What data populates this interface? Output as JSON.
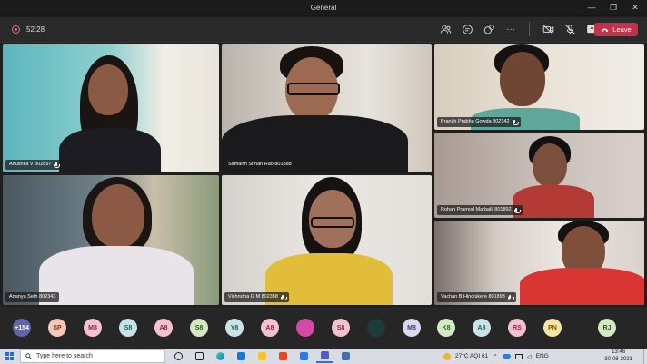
{
  "window": {
    "title": "General"
  },
  "window_controls": {
    "minimize": "—",
    "restore": "❐",
    "close": "✕"
  },
  "meeting": {
    "timer": "52:28",
    "leave_label": "Leave"
  },
  "toolbar_icons": [
    "people-icon",
    "chat-icon",
    "reactions-icon",
    "more-icon",
    "camera-off-icon",
    "mic-off-icon",
    "share-icon"
  ],
  "more_glyph": "···",
  "participants": [
    {
      "name": "Anushka V 802897"
    },
    {
      "name": "Samarth Srihari Rao 801888"
    },
    {
      "name": "Pranith Prabhu Gowda 802142"
    },
    {
      "name": "Rohan Pramod Marballi 801892"
    },
    {
      "name": "Ananya Seth 802343"
    },
    {
      "name": "Vishrutha G M 802358"
    },
    {
      "name": "Vachan B Hindiskere 801893"
    }
  ],
  "overflow_avatars": [
    {
      "label": "+154",
      "color": "#6264a7",
      "text": "#ffffff"
    },
    {
      "label": "SP",
      "color": "#f4c7b8",
      "text": "#7a2e1e"
    },
    {
      "label": "M8",
      "color": "#f4c2cf",
      "text": "#7d2a44"
    },
    {
      "label": "S8",
      "color": "#c9e3e4",
      "text": "#1f5a5e"
    },
    {
      "label": "A8",
      "color": "#f4c2cf",
      "text": "#7d2a44"
    },
    {
      "label": "S8",
      "color": "#d3e9c4",
      "text": "#2e5a1a"
    },
    {
      "label": "Y8",
      "color": "#c9e3e4",
      "text": "#1f5a5e"
    },
    {
      "label": "A8",
      "color": "#f4c2cf",
      "text": "#7d2a44"
    },
    {
      "label": "",
      "color": "#d24aa4",
      "text": "#ffffff"
    },
    {
      "label": "S8",
      "color": "#f4c2cf",
      "text": "#7d2a44"
    },
    {
      "label": "",
      "color": "#1e3a3a",
      "text": "#7ad3c0"
    },
    {
      "label": "M8",
      "color": "#d9d9ee",
      "text": "#3b3b7a"
    },
    {
      "label": "K8",
      "color": "#d3e9c4",
      "text": "#2e5a1a"
    },
    {
      "label": "A8",
      "color": "#c9e3e4",
      "text": "#1f5a5e"
    },
    {
      "label": "RS",
      "color": "#f4c2cf",
      "text": "#7d2a44"
    },
    {
      "label": "PN",
      "color": "#f7e3a4",
      "text": "#6b5410"
    },
    {
      "label": "RJ",
      "color": "#d3e9c4",
      "text": "#2e5a1a"
    }
  ],
  "taskbar": {
    "search_placeholder": "Type here to search",
    "apps": [
      "cortana-icon",
      "task-view-icon",
      "edge-icon",
      "store-icon",
      "file-explorer-icon",
      "office-icon",
      "mail-icon",
      "teams-icon",
      "calculator-icon"
    ],
    "weather": "27°C AQI 61",
    "lang": "ENG",
    "time": "13:46",
    "date": "30-08-2021"
  },
  "colors": {
    "accent": "#6264a7",
    "leave": "#c4314b"
  }
}
